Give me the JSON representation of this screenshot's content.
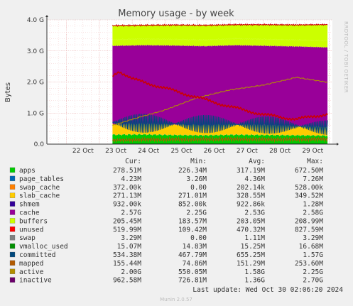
{
  "title": "Memory usage - by week",
  "side_label": "RRDTOOL / TOBI OETIKER",
  "footer": {
    "last_update": "Last update: Wed Oct 30 02:06:20 2024",
    "munin": "Munin 2.0.57"
  },
  "legend_headers": {
    "cur": "Cur:",
    "min": "Min:",
    "avg": "Avg:",
    "max": "Max:"
  },
  "legend": [
    {
      "name": "apps",
      "color": "#00cc00",
      "cur": "278.51M",
      "min": "226.34M",
      "avg": "317.19M",
      "max": "672.50M"
    },
    {
      "name": "page_tables",
      "color": "#0066b3",
      "cur": "4.23M",
      "min": "3.26M",
      "avg": "4.36M",
      "max": "7.26M"
    },
    {
      "name": "swap_cache",
      "color": "#ff8000",
      "cur": "372.00k",
      "min": "0.00",
      "avg": "202.14k",
      "max": "528.00k"
    },
    {
      "name": "slab_cache",
      "color": "#ffcc00",
      "cur": "271.13M",
      "min": "271.01M",
      "avg": "328.55M",
      "max": "349.52M"
    },
    {
      "name": "shmem",
      "color": "#330099",
      "cur": "932.00k",
      "min": "852.00k",
      "avg": "922.86k",
      "max": "1.28M"
    },
    {
      "name": "cache",
      "color": "#990099",
      "cur": "2.57G",
      "min": "2.25G",
      "avg": "2.53G",
      "max": "2.58G"
    },
    {
      "name": "buffers",
      "color": "#ccff00",
      "cur": "205.45M",
      "min": "183.57M",
      "avg": "203.05M",
      "max": "208.99M"
    },
    {
      "name": "unused",
      "color": "#ff0000",
      "cur": "519.99M",
      "min": "109.42M",
      "avg": "470.32M",
      "max": "827.59M"
    },
    {
      "name": "swap",
      "color": "#808080",
      "cur": "3.29M",
      "min": "0.00",
      "avg": "1.11M",
      "max": "3.29M"
    },
    {
      "name": "vmalloc_used",
      "color": "#008f00",
      "cur": "15.07M",
      "min": "14.83M",
      "avg": "15.25M",
      "max": "16.68M"
    },
    {
      "name": "committed",
      "color": "#00487d",
      "cur": "534.38M",
      "min": "467.79M",
      "avg": "655.25M",
      "max": "1.57G"
    },
    {
      "name": "mapped",
      "color": "#b35a00",
      "cur": "155.44M",
      "min": "74.86M",
      "avg": "151.29M",
      "max": "253.60M"
    },
    {
      "name": "active",
      "color": "#b38f00",
      "cur": "2.00G",
      "min": "550.05M",
      "avg": "1.58G",
      "max": "2.25G"
    },
    {
      "name": "inactive",
      "color": "#6b006b",
      "cur": "962.58M",
      "min": "726.81M",
      "avg": "1.36G",
      "max": "2.70G"
    }
  ],
  "chart_data": {
    "type": "area",
    "title": "Memory usage - by week",
    "ylabel": "Bytes",
    "ylim": [
      0,
      4.0
    ],
    "y_unit": "G",
    "y_ticks": [
      "0.0",
      "1.0 G",
      "2.0 G",
      "3.0 G",
      "4.0 G"
    ],
    "x_ticks": [
      "22 Oct",
      "23 Oct",
      "24 Oct",
      "25 Oct",
      "26 Oct",
      "27 Oct",
      "28 Oct",
      "29 Oct"
    ],
    "x_range": [
      21.4,
      30.1
    ],
    "data_start": 23.4,
    "stack_order": [
      "apps",
      "page_tables",
      "swap_cache",
      "slab_cache",
      "shmem",
      "cache",
      "buffers",
      "unused",
      "swap"
    ],
    "stacked_series": [
      {
        "name": "apps",
        "color": "#00cc00",
        "values": [
          0.3,
          0.31,
          0.29,
          0.28,
          0.3,
          0.29,
          0.28,
          0.27
        ]
      },
      {
        "name": "page_tables",
        "color": "#0066b3",
        "values": [
          0.004,
          0.004,
          0.004,
          0.004,
          0.004,
          0.004,
          0.004,
          0.004
        ]
      },
      {
        "name": "swap_cache",
        "color": "#ff8000",
        "values": [
          0.0002,
          0.0002,
          0.0002,
          0.0002,
          0.0002,
          0.0002,
          0.0003,
          0.0004
        ]
      },
      {
        "name": "slab_cache",
        "color": "#ffcc00",
        "values": [
          0.34,
          0.34,
          0.34,
          0.33,
          0.33,
          0.32,
          0.3,
          0.27
        ]
      },
      {
        "name": "shmem",
        "color": "#330099",
        "values": [
          0.001,
          0.001,
          0.001,
          0.001,
          0.001,
          0.001,
          0.001,
          0.001
        ]
      },
      {
        "name": "cache",
        "color": "#990099",
        "values": [
          2.52,
          2.53,
          2.54,
          2.54,
          2.55,
          2.55,
          2.56,
          2.57
        ]
      },
      {
        "name": "buffers",
        "color": "#ccff00",
        "values": [
          0.2,
          0.2,
          0.2,
          0.2,
          0.21,
          0.21,
          0.21,
          0.21
        ]
      },
      {
        "name": "unused",
        "color": "#ccff00",
        "values": [
          0.45,
          0.44,
          0.46,
          0.47,
          0.45,
          0.47,
          0.48,
          0.52
        ]
      },
      {
        "name": "swap",
        "color": "#ff0000",
        "values": [
          0.0,
          0.0,
          0.0,
          0.0,
          0.0,
          0.0,
          0.002,
          0.003
        ]
      }
    ],
    "line_series": [
      {
        "name": "committed",
        "color": "#00487d",
        "x": [
          23.4,
          24,
          25,
          26,
          27,
          28,
          29,
          29.9
        ],
        "values": [
          0.7,
          0.68,
          0.66,
          0.65,
          0.64,
          0.62,
          0.58,
          0.53
        ]
      },
      {
        "name": "vmalloc_used",
        "color": "#008f00",
        "x": [
          23.4,
          24,
          25,
          26,
          27,
          28,
          29,
          29.9
        ],
        "values": [
          0.015,
          0.015,
          0.015,
          0.015,
          0.015,
          0.015,
          0.015,
          0.015
        ]
      },
      {
        "name": "mapped",
        "color": "#b35a00",
        "x": [
          23.4,
          24,
          25,
          26,
          27,
          28,
          29,
          29.9
        ],
        "values": [
          0.12,
          0.14,
          0.15,
          0.15,
          0.16,
          0.15,
          0.15,
          0.16
        ]
      },
      {
        "name": "active",
        "color": "#b38f00",
        "x": [
          23.4,
          24,
          25,
          26,
          27,
          28,
          29,
          29.9
        ],
        "values": [
          0.6,
          0.8,
          1.1,
          1.5,
          1.75,
          1.9,
          2.15,
          2.0
        ]
      },
      {
        "name": "inactive",
        "color": "#cc0000",
        "x": [
          23.4,
          23.6,
          24,
          25,
          26,
          27,
          28,
          29,
          29.9
        ],
        "values": [
          2.2,
          2.35,
          2.1,
          1.8,
          1.5,
          1.2,
          0.95,
          0.8,
          0.96
        ]
      }
    ]
  }
}
